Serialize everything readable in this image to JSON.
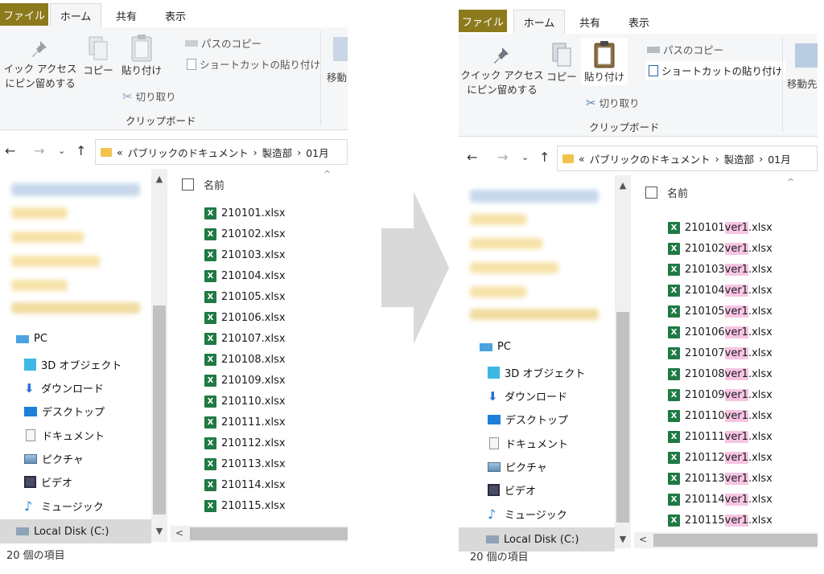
{
  "tabs": {
    "file": "ファイル",
    "home": "ホーム",
    "share": "共有",
    "view": "表示"
  },
  "ribbon": {
    "pin_line1": "クイック アクセス",
    "pin_line1_left": "イック アクセス",
    "pin_line2": "にピン留めする",
    "copy": "コピー",
    "paste": "貼り付け",
    "copy_path": "パスのコピー",
    "paste_shortcut": "ショートカットの貼り付け",
    "cut": "切り取り",
    "group": "クリップボード",
    "move_left": "移動",
    "move_right": "移動先"
  },
  "address": {
    "chevrons": "«",
    "segments": [
      "パブリックのドキュメント",
      "製造部",
      "01月"
    ],
    "separator": "›"
  },
  "nav": {
    "pc": "PC",
    "items": [
      "3D オブジェクト",
      "ダウンロード",
      "デスクトップ",
      "ドキュメント",
      "ピクチャ",
      "ビデオ",
      "ミュージック"
    ],
    "local_disk": "Local Disk (C:)"
  },
  "files": {
    "column": "名前",
    "ext": ".xlsx",
    "suffix": "ver1",
    "names": [
      "210101",
      "210102",
      "210103",
      "210104",
      "210105",
      "210106",
      "210107",
      "210108",
      "210109",
      "210110",
      "210111",
      "210112",
      "210113",
      "210114",
      "210115"
    ]
  },
  "status": "20 個の項目",
  "colors": {
    "file_tab": "#8c7a1c",
    "excel": "#1f7a43",
    "highlight": "#f7c5e3"
  }
}
